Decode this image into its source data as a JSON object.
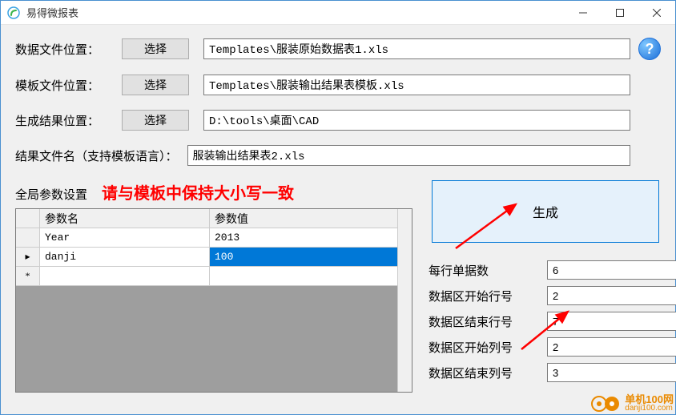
{
  "window": {
    "title": "易得微报表"
  },
  "labels": {
    "data_file_location": "数据文件位置：",
    "template_file_location": "模板文件位置：",
    "output_location": "生成结果位置：",
    "output_filename": "结果文件名（支持模板语言）：",
    "global_params": "全局参数设置",
    "warn": "请与模板中保持大小写一致",
    "select": "选择",
    "generate": "生成",
    "col_param_name": "参数名",
    "col_param_value": "参数值",
    "per_row_docs": "每行单据数",
    "data_start_row": "数据区开始行号",
    "data_end_row": "数据区结束行号",
    "data_start_col": "数据区开始列号",
    "data_end_col": "数据区结束列号"
  },
  "paths": {
    "data_file": "Templates\\服装原始数据表1.xls",
    "template_file": "Templates\\服装输出结果表模板.xls",
    "output_dir": "D:\\tools\\桌面\\CAD",
    "output_name": "服装输出结果表2.xls"
  },
  "params": {
    "rows": {
      "0": {
        "name": "Year",
        "value": "2013"
      },
      "1": {
        "name": "danji",
        "value": "100"
      }
    }
  },
  "spinners": {
    "per_row_docs": "6",
    "data_start_row": "2",
    "data_end_row": "7",
    "data_start_col": "2",
    "data_end_col": "3"
  },
  "watermark": {
    "name": "单机100网",
    "domain": "danji100.com"
  }
}
